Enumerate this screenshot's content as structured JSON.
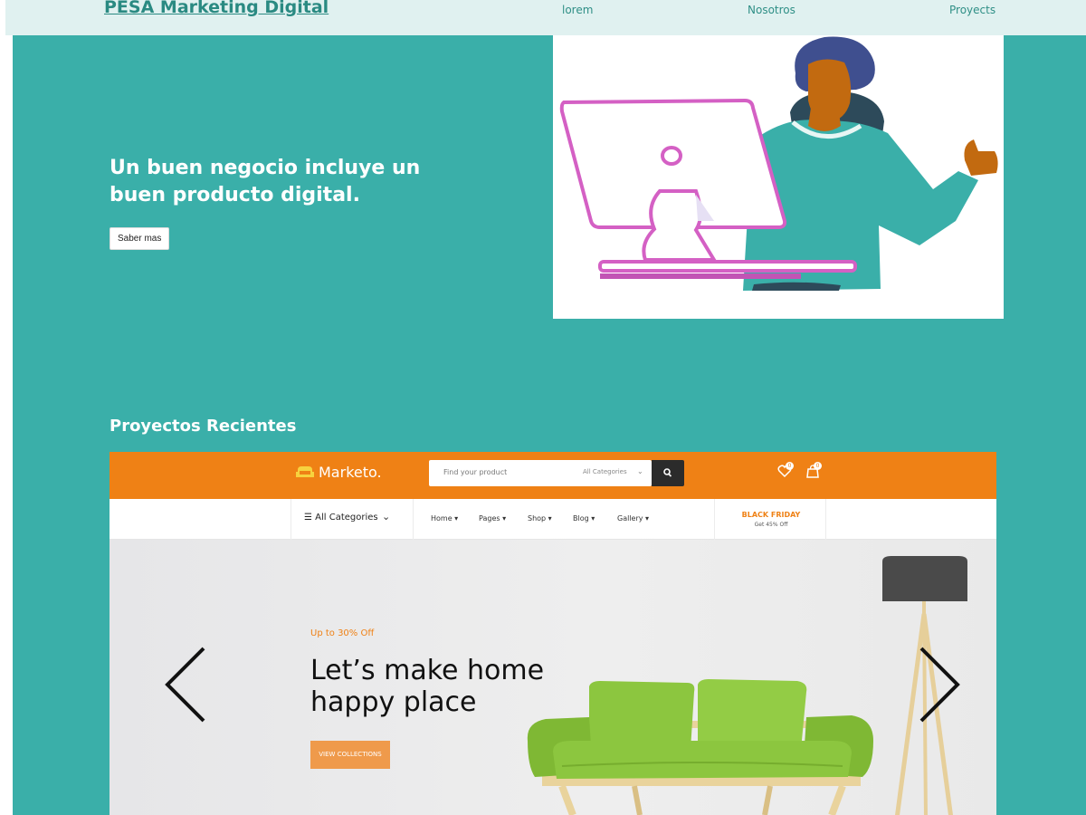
{
  "nav": {
    "brand": "PESA Marketing Digital",
    "links": [
      "lorem",
      "Nosotros",
      "Proyects"
    ]
  },
  "hero": {
    "title": "Un buen negocio incluye un buen producto digital.",
    "button_label": "Saber mas"
  },
  "projects": {
    "heading": "Proyectos Recientes"
  },
  "project_preview": {
    "logo": "Marketo.",
    "search_placeholder": "Find your product",
    "search_category": "All Categories",
    "wishlist_count": "0",
    "cart_count": "0",
    "categories_label": "All Categories",
    "menu": [
      "Home",
      "Pages",
      "Shop",
      "Blog",
      "Gallery"
    ],
    "promo_title": "BLACK FRIDAY",
    "promo_sub": "Get 45% Off",
    "offer": "Up to 30% Off",
    "headline": "Let’s make home happy place",
    "cta": "VIEW COLLECTIONS"
  },
  "colors": {
    "page_bg": "#3aafa9",
    "nav_bg": "#e0f1f0",
    "brand": "#2a8a82",
    "marketo_orange": "#ef8115",
    "sofa_green": "#8cc63f"
  },
  "icons": [
    "menu-list-icon",
    "chevron-down-icon",
    "search-icon",
    "heart-icon",
    "bag-icon",
    "sofa-logo-icon",
    "arrow-left-icon",
    "arrow-right-icon"
  ]
}
